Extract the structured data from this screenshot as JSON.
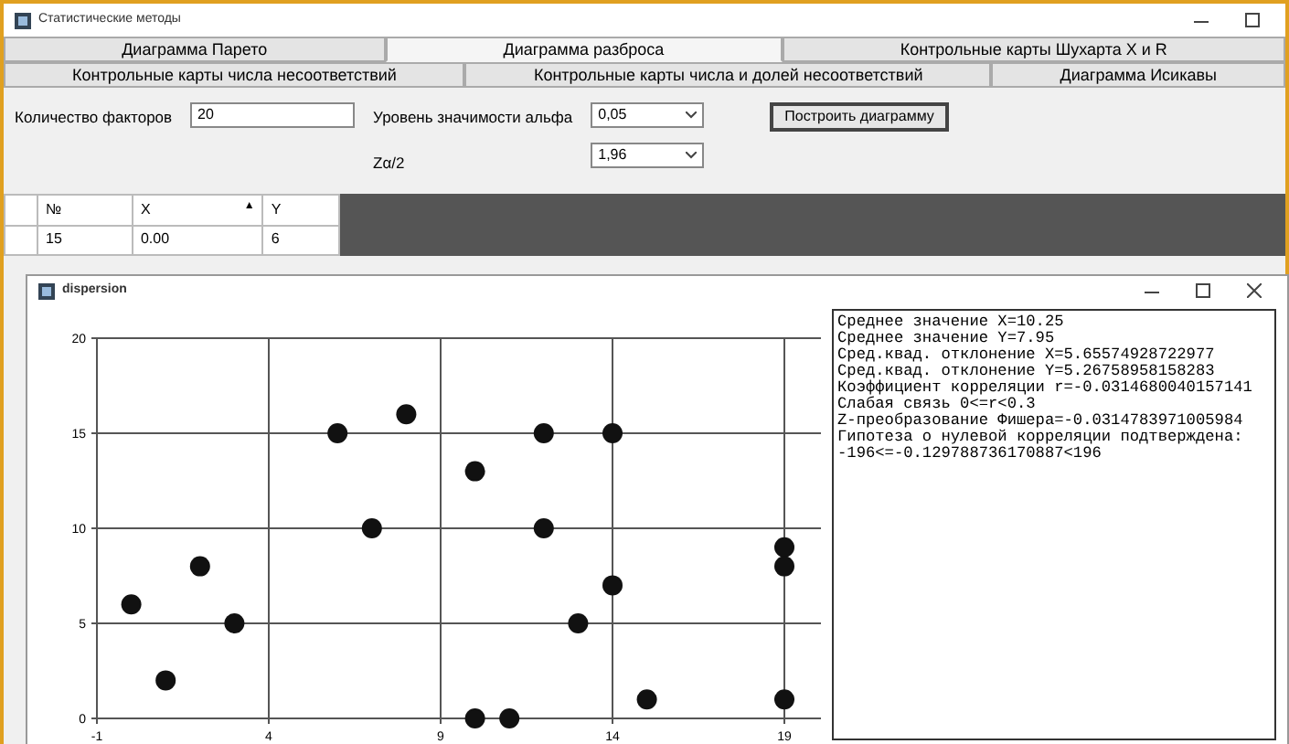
{
  "window": {
    "title": "Статистические методы"
  },
  "tab_rows": [
    [
      {
        "label": "Диаграмма Парето",
        "selected": false
      },
      {
        "label": "Диаграмма разброса",
        "selected": true
      },
      {
        "label": "Контрольные карты Шухарта X и R",
        "selected": false
      }
    ],
    [
      {
        "label": "Контрольные карты числа несоответствий",
        "selected": false
      },
      {
        "label": "Контрольные карты числа и долей несоответствий",
        "selected": false
      },
      {
        "label": "Диаграмма Исикавы",
        "selected": false
      }
    ]
  ],
  "form": {
    "factors_label": "Количество факторов",
    "factors_value": "20",
    "alpha_label": "Уровень значимости альфа",
    "alpha_value": "0,05",
    "z_label": "Zα/2",
    "z_value": "1,96",
    "build_button": "Построить диаграмму"
  },
  "table": {
    "columns": [
      {
        "label": "№"
      },
      {
        "label": "X",
        "sort": "▲"
      },
      {
        "label": "Y"
      }
    ],
    "rows": [
      [
        "15",
        "0.00",
        "6"
      ]
    ]
  },
  "child_window": {
    "title": "dispersion",
    "chart_data": {
      "type": "scatter",
      "grid": true,
      "xlim": [
        -1,
        19
      ],
      "ylim": [
        0,
        20
      ],
      "xticks": [
        {
          "value": -1,
          "label": "-1"
        },
        {
          "value": 4,
          "label": "4"
        },
        {
          "value": 9,
          "label": "9"
        },
        {
          "value": 14,
          "label": "14"
        },
        {
          "value": 19,
          "label": "19"
        }
      ],
      "yticks": [
        0,
        5,
        10,
        15,
        20
      ],
      "series": [
        {
          "color": "#111111",
          "x": [
            0,
            1,
            2,
            3,
            6,
            7,
            8,
            10,
            10,
            11,
            12,
            12,
            13,
            14,
            14,
            15,
            19,
            19,
            19
          ],
          "values": [
            6,
            2,
            8,
            5,
            15,
            10,
            16,
            13,
            0,
            0,
            15,
            10,
            5,
            15,
            7,
            1,
            9,
            8,
            1
          ]
        }
      ]
    },
    "results": [
      "Среднее значение X=10.25",
      "Среднее значение Y=7.95",
      "Сред.квад. отклонение X=5.65574928722977",
      "Сред.квад. отклонение Y=5.26758958158283",
      "Коэффициент корреляции r=-0.0314680040157141",
      "Слабая связь 0<=r<0.3",
      "Z-преобразование Фишера=-0.0314783971005984",
      "Гипотеза о нулевой корреляции подтверждена:",
      "-196<=-0.129788736170887<196"
    ]
  }
}
